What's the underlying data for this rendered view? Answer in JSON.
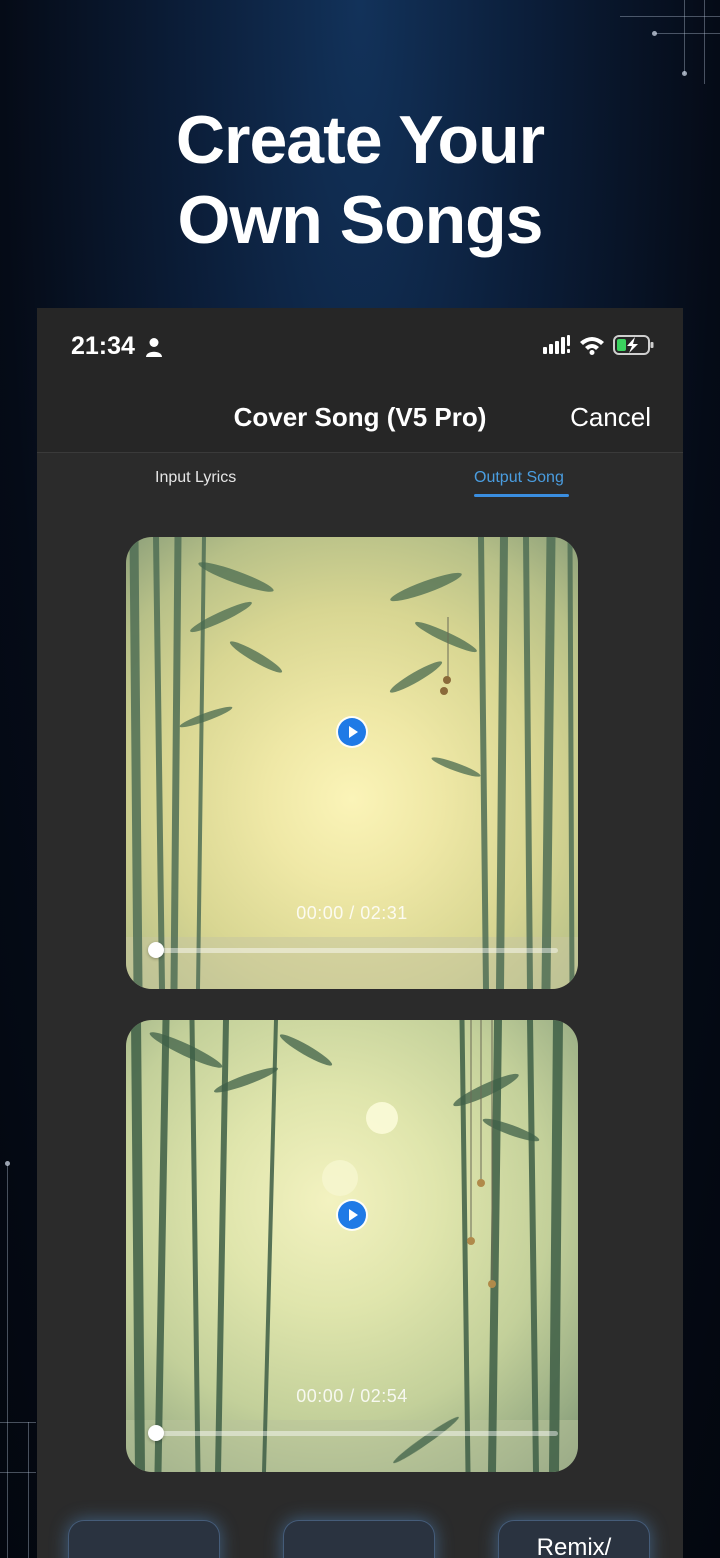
{
  "headline": {
    "line1": "Create Your",
    "line2": "Own  Songs"
  },
  "status_bar": {
    "time": "21:34",
    "icons": [
      "person-icon",
      "signal-icon",
      "wifi-icon",
      "battery-charging-icon"
    ]
  },
  "nav": {
    "title": "Cover Song (V5 Pro)",
    "cancel_label": "Cancel"
  },
  "tabs": [
    {
      "label": "Input Lyrics",
      "active": false
    },
    {
      "label": "Output Song",
      "active": true
    }
  ],
  "songs": [
    {
      "time": "00:00 / 02:31",
      "progress": 0
    },
    {
      "time": "00:00 / 02:54",
      "progress": 0
    }
  ],
  "bottom_buttons": [
    {
      "label": ""
    },
    {
      "label": ""
    },
    {
      "label": "Remix/"
    }
  ],
  "colors": {
    "accent": "#3a8ee0",
    "play_button": "#1f7ae6",
    "panel": "#2b2b2b"
  }
}
